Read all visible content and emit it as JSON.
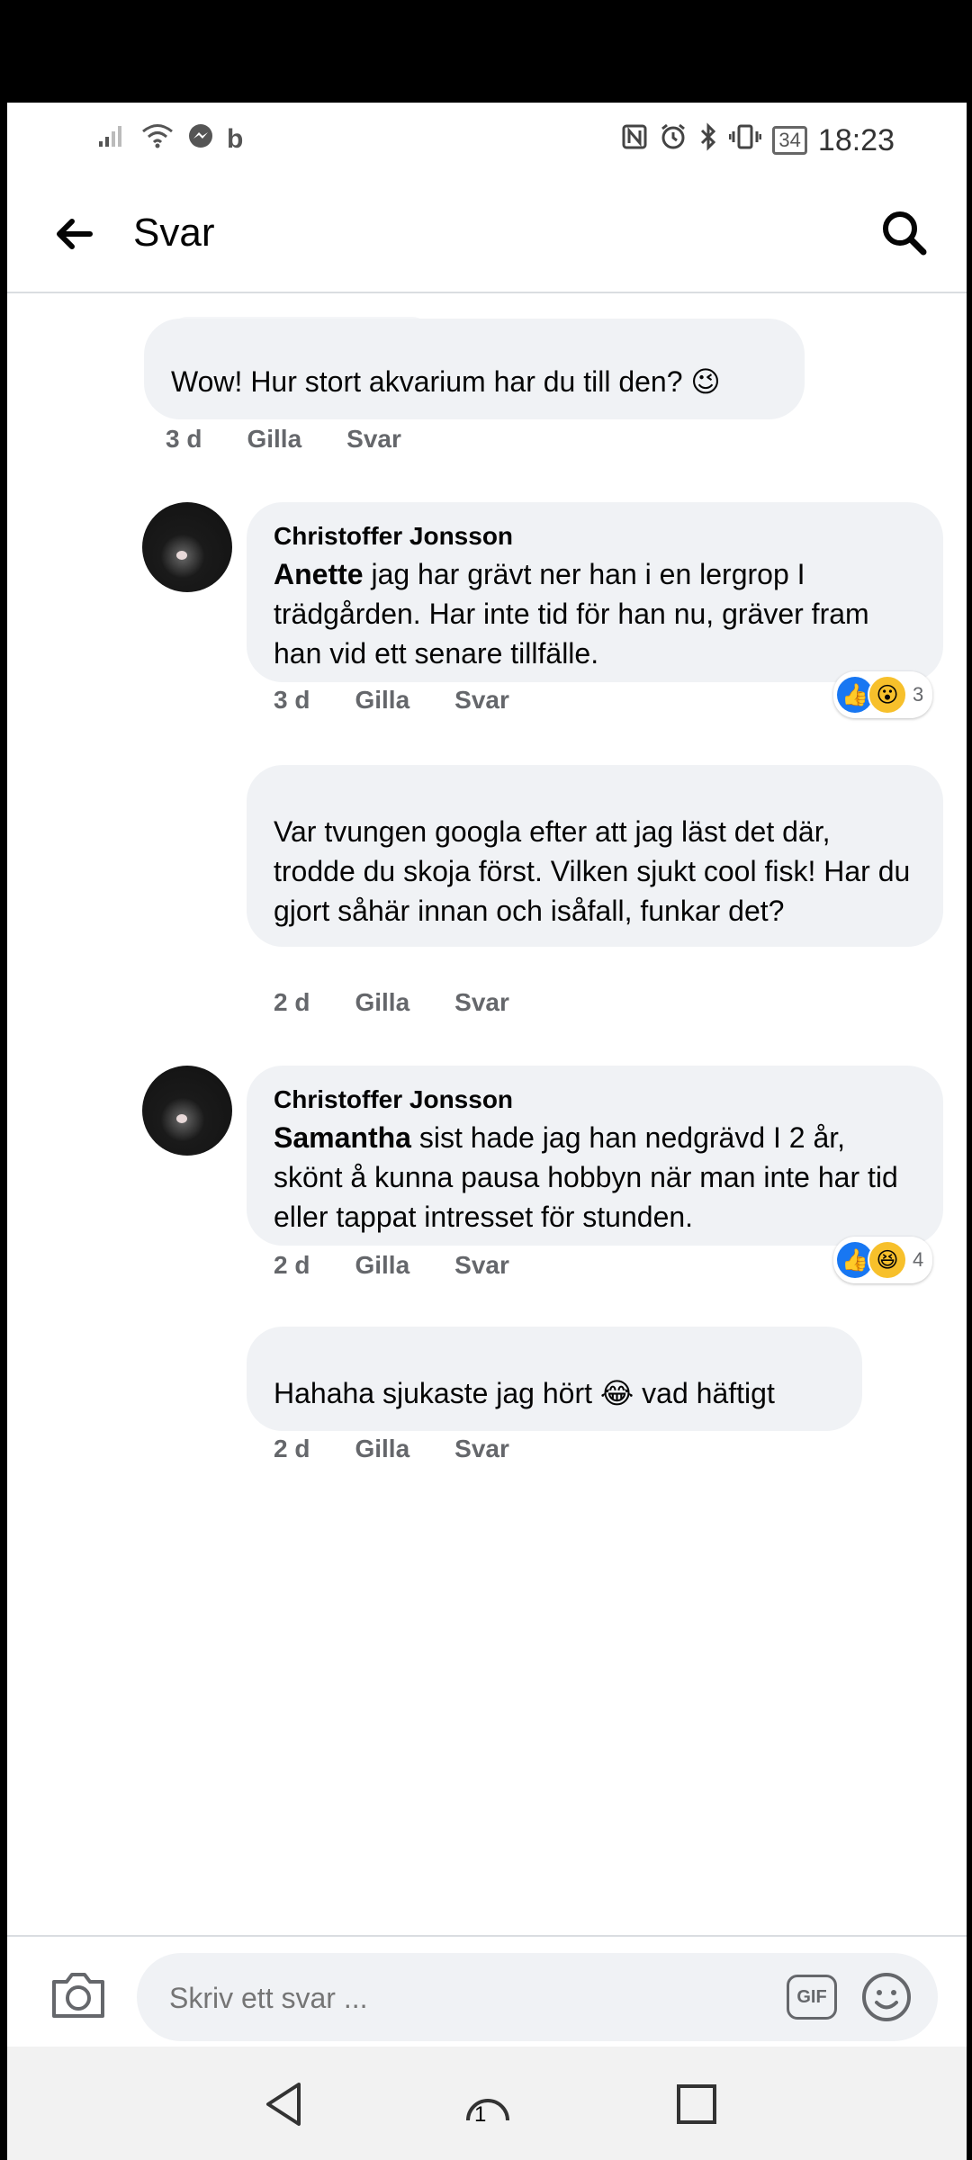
{
  "status_bar": {
    "left_icons": [
      "signal-icon",
      "wifi-icon",
      "messenger-icon",
      "b-icon"
    ],
    "right_icons": [
      "nfc-icon",
      "alarm-icon",
      "bluetooth-icon",
      "vibrate-icon"
    ],
    "battery": "34",
    "time": "18:23"
  },
  "header": {
    "title": "Svar"
  },
  "comments": [
    {
      "author": "",
      "mention": "",
      "text": "Wow! Hur stort akvarium har du till den? 😉",
      "time": "3 d",
      "like_label": "Gilla",
      "reply_label": "Svar"
    },
    {
      "author": "Christoffer Jonsson",
      "mention": "Anette",
      "text": " jag har grävt ner han i en lergrop I trädgården. Har inte tid för han nu, gräver fram han vid ett senare tillfälle.",
      "time": "3 d",
      "like_label": "Gilla",
      "reply_label": "Svar",
      "reactions": {
        "like": "👍",
        "emoji": "😮",
        "count": "3"
      }
    },
    {
      "author": "",
      "mention": "",
      "text": "Var tvungen googla efter att jag läst det där, trodde du skoja först. Vilken sjukt cool fisk! Har du gjort såhär innan och isåfall, funkar det?",
      "time": "2 d",
      "like_label": "Gilla",
      "reply_label": "Svar"
    },
    {
      "author": "Christoffer Jonsson",
      "mention": "Samantha",
      "text": " sist hade jag han nedgrävd I 2 år, skönt å kunna pausa hobbyn när man inte har tid eller tappat intresset för stunden.",
      "time": "2 d",
      "like_label": "Gilla",
      "reply_label": "Svar",
      "reactions": {
        "like": "👍",
        "emoji": "😆",
        "count": "4"
      }
    },
    {
      "author": "",
      "mention": "",
      "text": "Hahaha sjukaste jag hört 😂 vad häftigt",
      "time": "2 d",
      "like_label": "Gilla",
      "reply_label": "Svar"
    }
  ],
  "composer": {
    "placeholder": "Skriv ett svar ...",
    "gif_label": "GIF"
  },
  "navbar": {
    "home_badge": "1"
  }
}
